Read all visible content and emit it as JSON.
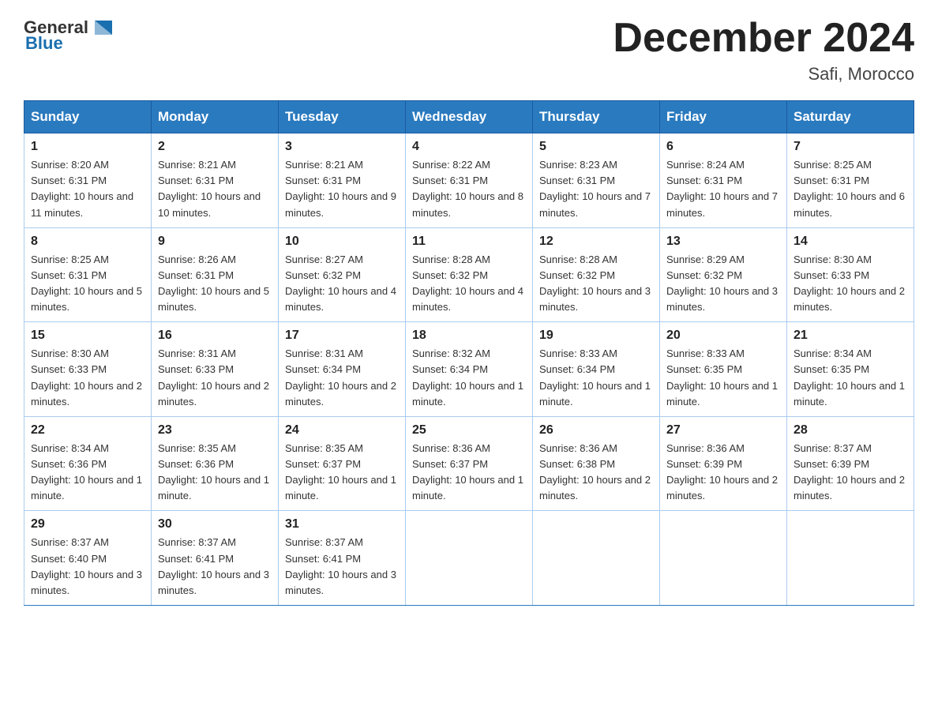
{
  "header": {
    "logo_general": "General",
    "logo_blue": "Blue",
    "title": "December 2024",
    "subtitle": "Safi, Morocco"
  },
  "days_of_week": [
    "Sunday",
    "Monday",
    "Tuesday",
    "Wednesday",
    "Thursday",
    "Friday",
    "Saturday"
  ],
  "weeks": [
    [
      {
        "day": "1",
        "sunrise": "8:20 AM",
        "sunset": "6:31 PM",
        "daylight": "10 hours and 11 minutes."
      },
      {
        "day": "2",
        "sunrise": "8:21 AM",
        "sunset": "6:31 PM",
        "daylight": "10 hours and 10 minutes."
      },
      {
        "day": "3",
        "sunrise": "8:21 AM",
        "sunset": "6:31 PM",
        "daylight": "10 hours and 9 minutes."
      },
      {
        "day": "4",
        "sunrise": "8:22 AM",
        "sunset": "6:31 PM",
        "daylight": "10 hours and 8 minutes."
      },
      {
        "day": "5",
        "sunrise": "8:23 AM",
        "sunset": "6:31 PM",
        "daylight": "10 hours and 7 minutes."
      },
      {
        "day": "6",
        "sunrise": "8:24 AM",
        "sunset": "6:31 PM",
        "daylight": "10 hours and 7 minutes."
      },
      {
        "day": "7",
        "sunrise": "8:25 AM",
        "sunset": "6:31 PM",
        "daylight": "10 hours and 6 minutes."
      }
    ],
    [
      {
        "day": "8",
        "sunrise": "8:25 AM",
        "sunset": "6:31 PM",
        "daylight": "10 hours and 5 minutes."
      },
      {
        "day": "9",
        "sunrise": "8:26 AM",
        "sunset": "6:31 PM",
        "daylight": "10 hours and 5 minutes."
      },
      {
        "day": "10",
        "sunrise": "8:27 AM",
        "sunset": "6:32 PM",
        "daylight": "10 hours and 4 minutes."
      },
      {
        "day": "11",
        "sunrise": "8:28 AM",
        "sunset": "6:32 PM",
        "daylight": "10 hours and 4 minutes."
      },
      {
        "day": "12",
        "sunrise": "8:28 AM",
        "sunset": "6:32 PM",
        "daylight": "10 hours and 3 minutes."
      },
      {
        "day": "13",
        "sunrise": "8:29 AM",
        "sunset": "6:32 PM",
        "daylight": "10 hours and 3 minutes."
      },
      {
        "day": "14",
        "sunrise": "8:30 AM",
        "sunset": "6:33 PM",
        "daylight": "10 hours and 2 minutes."
      }
    ],
    [
      {
        "day": "15",
        "sunrise": "8:30 AM",
        "sunset": "6:33 PM",
        "daylight": "10 hours and 2 minutes."
      },
      {
        "day": "16",
        "sunrise": "8:31 AM",
        "sunset": "6:33 PM",
        "daylight": "10 hours and 2 minutes."
      },
      {
        "day": "17",
        "sunrise": "8:31 AM",
        "sunset": "6:34 PM",
        "daylight": "10 hours and 2 minutes."
      },
      {
        "day": "18",
        "sunrise": "8:32 AM",
        "sunset": "6:34 PM",
        "daylight": "10 hours and 1 minute."
      },
      {
        "day": "19",
        "sunrise": "8:33 AM",
        "sunset": "6:34 PM",
        "daylight": "10 hours and 1 minute."
      },
      {
        "day": "20",
        "sunrise": "8:33 AM",
        "sunset": "6:35 PM",
        "daylight": "10 hours and 1 minute."
      },
      {
        "day": "21",
        "sunrise": "8:34 AM",
        "sunset": "6:35 PM",
        "daylight": "10 hours and 1 minute."
      }
    ],
    [
      {
        "day": "22",
        "sunrise": "8:34 AM",
        "sunset": "6:36 PM",
        "daylight": "10 hours and 1 minute."
      },
      {
        "day": "23",
        "sunrise": "8:35 AM",
        "sunset": "6:36 PM",
        "daylight": "10 hours and 1 minute."
      },
      {
        "day": "24",
        "sunrise": "8:35 AM",
        "sunset": "6:37 PM",
        "daylight": "10 hours and 1 minute."
      },
      {
        "day": "25",
        "sunrise": "8:36 AM",
        "sunset": "6:37 PM",
        "daylight": "10 hours and 1 minute."
      },
      {
        "day": "26",
        "sunrise": "8:36 AM",
        "sunset": "6:38 PM",
        "daylight": "10 hours and 2 minutes."
      },
      {
        "day": "27",
        "sunrise": "8:36 AM",
        "sunset": "6:39 PM",
        "daylight": "10 hours and 2 minutes."
      },
      {
        "day": "28",
        "sunrise": "8:37 AM",
        "sunset": "6:39 PM",
        "daylight": "10 hours and 2 minutes."
      }
    ],
    [
      {
        "day": "29",
        "sunrise": "8:37 AM",
        "sunset": "6:40 PM",
        "daylight": "10 hours and 3 minutes."
      },
      {
        "day": "30",
        "sunrise": "8:37 AM",
        "sunset": "6:41 PM",
        "daylight": "10 hours and 3 minutes."
      },
      {
        "day": "31",
        "sunrise": "8:37 AM",
        "sunset": "6:41 PM",
        "daylight": "10 hours and 3 minutes."
      },
      null,
      null,
      null,
      null
    ]
  ]
}
